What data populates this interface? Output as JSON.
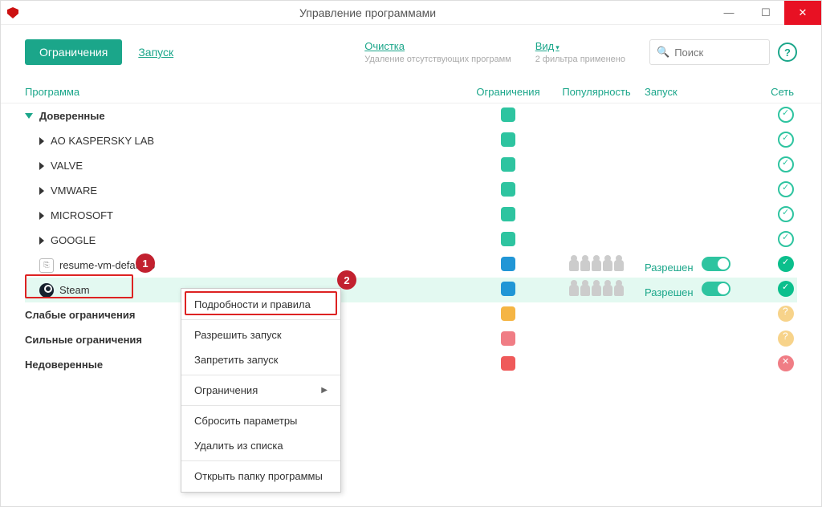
{
  "titlebar": {
    "title": "Управление программами"
  },
  "toolbar": {
    "restrictions_tab": "Ограничения",
    "launch_tab": "Запуск",
    "cleanup": {
      "label": "Очистка",
      "sub": "Удаление отсутствующих программ"
    },
    "view": {
      "label": "Вид",
      "sub": "2 фильтра применено"
    },
    "search_placeholder": "Поиск"
  },
  "columns": {
    "program": "Программа",
    "restrictions": "Ограничения",
    "popularity": "Популярность",
    "launch": "Запуск",
    "network": "Сеть"
  },
  "groups": {
    "trusted": "Доверенные",
    "weak": "Слабые ограничения",
    "strong": "Сильные ограничения",
    "untrusted": "Недоверенные"
  },
  "vendors": [
    "AO KASPERSKY LAB",
    "VALVE",
    "VMWARE",
    "MICROSOFT",
    "GOOGLE"
  ],
  "apps": {
    "resume": "resume-vm-default.b",
    "steam": "Steam"
  },
  "launch_status": "Разрешен",
  "ctx": {
    "details": "Подробности и правила",
    "allow": "Разрешить запуск",
    "deny": "Запретить запуск",
    "restrictions": "Ограничения",
    "reset": "Сбросить параметры",
    "remove": "Удалить из списка",
    "openfolder": "Открыть папку программы"
  },
  "annotations": {
    "one": "1",
    "two": "2"
  }
}
